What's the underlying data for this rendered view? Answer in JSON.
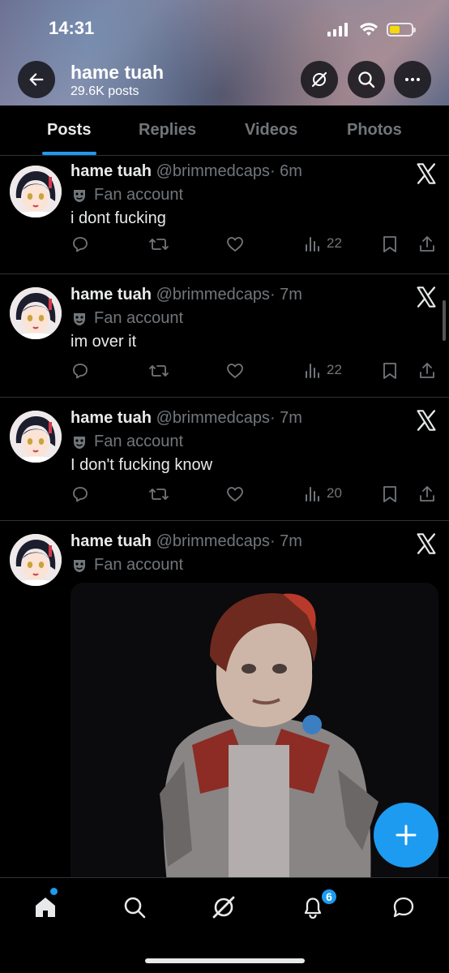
{
  "status_bar": {
    "time": "14:31"
  },
  "header": {
    "title": "hame tuah",
    "subtitle": "29.6K posts"
  },
  "tabs": [
    {
      "label": "Posts",
      "active": true
    },
    {
      "label": "Replies",
      "active": false
    },
    {
      "label": "Videos",
      "active": false
    },
    {
      "label": "Photos",
      "active": false
    }
  ],
  "posts": [
    {
      "name": "hame tuah",
      "handle": "@brimmedcaps",
      "time": "· 6m",
      "label": "Fan account",
      "text": "i dont fucking",
      "views": "22"
    },
    {
      "name": "hame tuah",
      "handle": "@brimmedcaps",
      "time": "· 7m",
      "label": "Fan account",
      "text": "im over it",
      "views": "22"
    },
    {
      "name": "hame tuah",
      "handle": "@brimmedcaps",
      "time": "· 7m",
      "label": "Fan account",
      "text": "I don't fucking know",
      "views": "20"
    },
    {
      "name": "hame tuah",
      "handle": "@brimmedcaps",
      "time": "· 7m",
      "label": "Fan account",
      "text": "",
      "views": ""
    }
  ],
  "bottom_nav": {
    "notifications_badge": "6"
  },
  "icons": {
    "back": "back-arrow-icon",
    "grok": "grok-icon",
    "search": "search-icon",
    "more": "more-icon",
    "reply": "reply-icon",
    "repost": "repost-icon",
    "like": "heart-icon",
    "views": "views-icon",
    "bookmark": "bookmark-icon",
    "share": "share-icon",
    "compose": "plus-icon",
    "home": "home-icon",
    "explore": "search-icon",
    "notifications": "bell-icon",
    "messages": "message-icon"
  },
  "colors": {
    "accent": "#1d9bf0",
    "background": "#000000",
    "muted": "#71767b",
    "battery": "#f5d90b"
  }
}
